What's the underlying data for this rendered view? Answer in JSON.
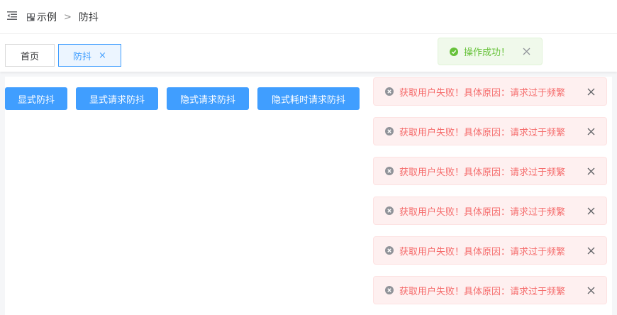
{
  "breadcrumb": {
    "items": [
      {
        "label": "示例"
      },
      {
        "label": "防抖"
      }
    ],
    "separator": ">"
  },
  "tags": [
    {
      "label": "首页",
      "active": false
    },
    {
      "label": "防抖",
      "active": true,
      "close": "×"
    }
  ],
  "buttons": [
    {
      "label": "显式防抖"
    },
    {
      "label": "显式请求防抖"
    },
    {
      "label": "隐式请求防抖"
    },
    {
      "label": "隐式耗时请求防抖"
    }
  ],
  "messages": {
    "success": {
      "text": "操作成功！",
      "color": "#67c23a"
    },
    "errors": [
      {
        "text": "获取用户失败！具体原因：请求过于频繁"
      },
      {
        "text": "获取用户失败！具体原因：请求过于频繁"
      },
      {
        "text": "获取用户失败！具体原因：请求过于频繁"
      },
      {
        "text": "获取用户失败！具体原因：请求过于频繁"
      },
      {
        "text": "获取用户失败！具体原因：请求过于频繁"
      },
      {
        "text": "获取用户失败！具体原因：请求过于频繁"
      }
    ],
    "error_color": "#f56c6c"
  },
  "colors": {
    "primary": "#409eff",
    "success": "#67c23a",
    "danger": "#f56c6c"
  }
}
